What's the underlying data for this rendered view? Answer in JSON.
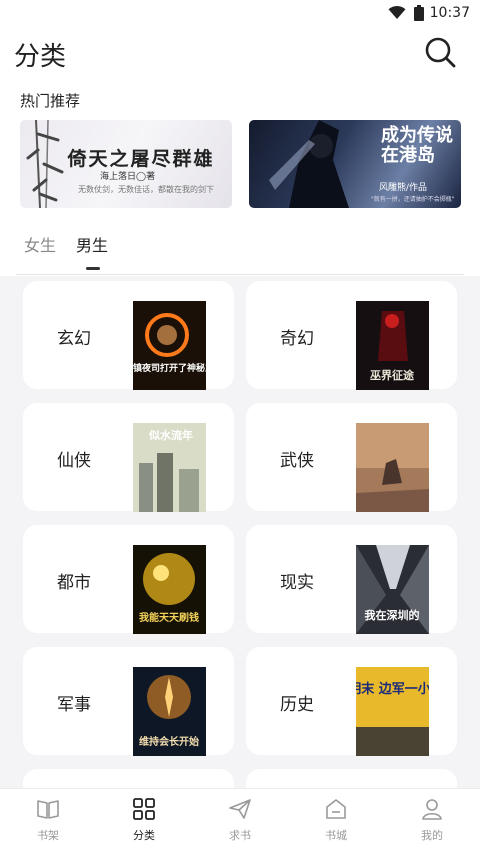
{
  "status": {
    "time": "10:37"
  },
  "header": {
    "title": "分类"
  },
  "hot": {
    "title": "热门推荐",
    "banners": [
      {
        "title": "倚天之屠尽群雄",
        "author": "海上落日◯著",
        "subtitle": "无数仗剑，无数佳话，都散在我的剑下"
      },
      {
        "title": "成为传说 在港岛",
        "author": "风雕熊/作品",
        "subtitle": "\"就有一拼，还请抽护不会掷瓶\""
      }
    ]
  },
  "tabs": [
    {
      "label": "女生",
      "active": false
    },
    {
      "label": "男生",
      "active": true
    }
  ],
  "categories": [
    {
      "label": "玄幻",
      "cover_title": "我在镇夜司打开了神秘之门",
      "cover_top": ""
    },
    {
      "label": "奇幻",
      "cover_title": "巫界征途",
      "cover_top": ""
    },
    {
      "label": "仙侠",
      "cover_title": "",
      "cover_top": "似水流年"
    },
    {
      "label": "武侠",
      "cover_title": "",
      "cover_top": ""
    },
    {
      "label": "都市",
      "cover_title": "我能天天刷钱",
      "cover_top": ""
    },
    {
      "label": "现实",
      "cover_title": "我在深圳的",
      "cover_top": ""
    },
    {
      "label": "军事",
      "cover_title": "维持会长开始",
      "cover_top": ""
    },
    {
      "label": "历史",
      "cover_title": "明末 边军一小兵",
      "cover_top": ""
    }
  ],
  "nav": [
    {
      "label": "书架",
      "icon": "book-icon",
      "active": false
    },
    {
      "label": "分类",
      "icon": "grid-icon",
      "active": true
    },
    {
      "label": "求书",
      "icon": "send-icon",
      "active": false
    },
    {
      "label": "书城",
      "icon": "store-icon",
      "active": false
    },
    {
      "label": "我的",
      "icon": "user-icon",
      "active": false
    }
  ]
}
